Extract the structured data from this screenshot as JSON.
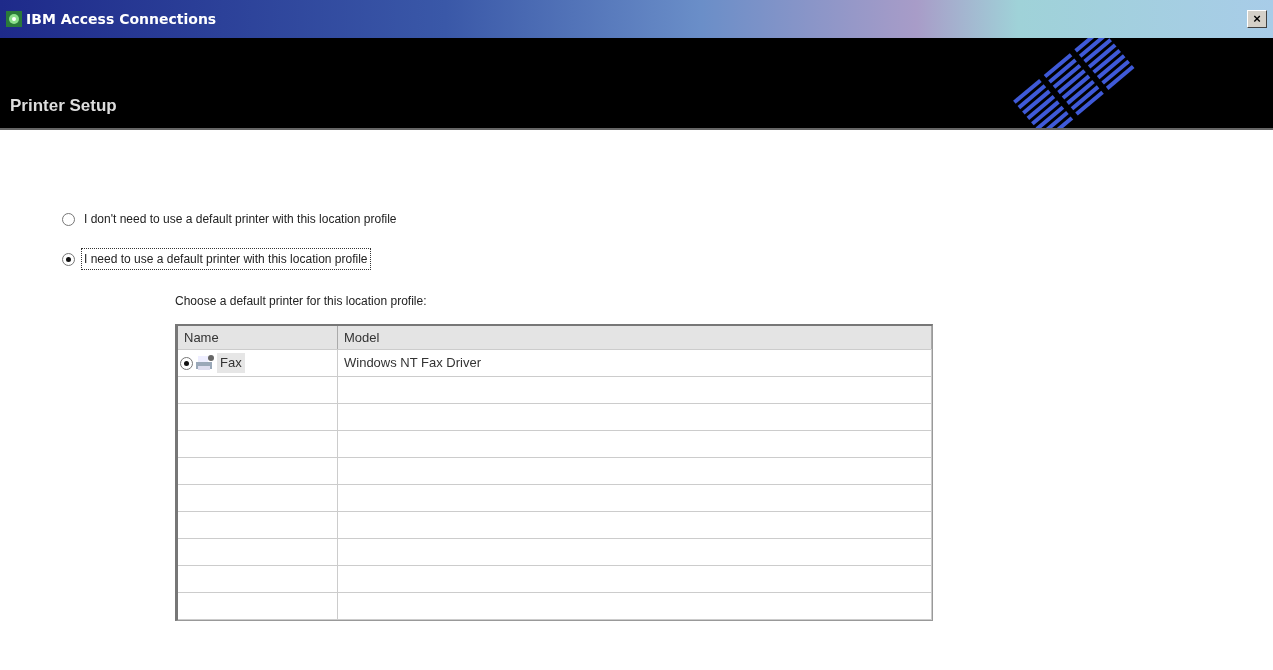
{
  "window": {
    "title": "IBM Access Connections",
    "close": "×"
  },
  "header": {
    "title": "Printer Setup"
  },
  "options": [
    {
      "label": "I don't need to use a default printer with this location profile",
      "selected": false,
      "focused": false
    },
    {
      "label": "I need to use a default printer with this location profile",
      "selected": true,
      "focused": true
    }
  ],
  "printer_list": {
    "caption": "Choose a default printer for this location profile:",
    "columns": [
      "Name",
      "Model"
    ],
    "rows": [
      {
        "name": "Fax",
        "model": "Windows NT Fax Driver",
        "selected": true
      }
    ]
  }
}
